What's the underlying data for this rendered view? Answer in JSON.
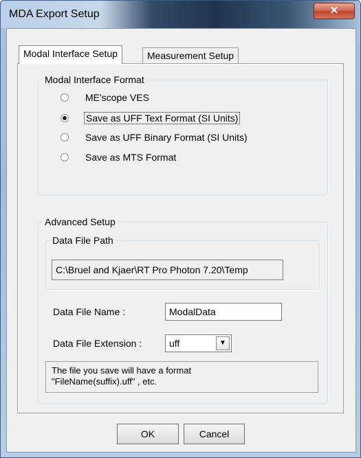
{
  "window": {
    "title": "MDA Export Setup",
    "close_glyph": "✕"
  },
  "tabs": [
    {
      "label": "Modal Interface Setup",
      "active": true
    },
    {
      "label": "Measurement Setup",
      "active": false
    }
  ],
  "modal_format": {
    "legend": "Modal Interface Format",
    "options": [
      {
        "label": "ME'scope VES",
        "checked": false
      },
      {
        "label": "Save as UFF Text Format (SI Units)",
        "checked": true
      },
      {
        "label": "Save as UFF Binary Format (SI Units)",
        "checked": false
      },
      {
        "label": "Save as MTS Format",
        "checked": false
      }
    ]
  },
  "advanced": {
    "legend": "Advanced Setup",
    "path_legend": "Data File Path",
    "path_value": "C:\\Bruel and Kjaer\\RT Pro Photon 7.20\\Temp",
    "file_name_label": "Data File Name :",
    "file_name_value": "ModalData",
    "extension_label": "Data File Extension :",
    "extension_value": "uff",
    "info_line1": "The file you save will have a format",
    "info_line2": "\"FileName(suffix).uff\" , etc."
  },
  "buttons": {
    "ok": "OK",
    "cancel": "Cancel"
  },
  "icons": {
    "dropdown": "chevron-down-icon",
    "close": "close-icon"
  }
}
